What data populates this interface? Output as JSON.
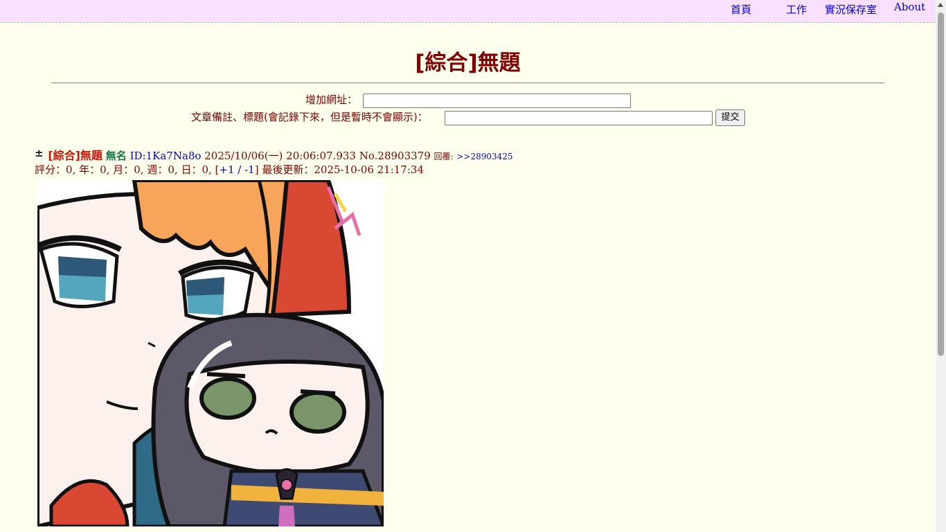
{
  "nav": {
    "home": "首頁",
    "work": "工作",
    "archive": "實況保存室",
    "about": "About"
  },
  "board": {
    "title": "[綜合]無題"
  },
  "form": {
    "url_label": "增加網址：",
    "note_label": "文章備註、標題(會記錄下來，但是暫時不會顯示)：",
    "submit_label": "提交"
  },
  "post": {
    "toggle": "±",
    "title": "[綜合]無題",
    "name": "無名",
    "id": "ID:1Ka7Na8o",
    "datetime": "2025/10/06(一) 20:06:07.933",
    "number": "No.28903379",
    "reply_label": "回覆:",
    "reply_link": ">>28903425",
    "stats": {
      "score_label": "評分：",
      "score": "0",
      "year_label": "年：",
      "year": "0",
      "month_label": "月：",
      "month": "0",
      "week_label": "週：",
      "week": "0",
      "day_label": "日：",
      "day": "0",
      "vote_up": "+1",
      "vote_down": "-1",
      "updated_label": "最後更新：",
      "updated": "2025-10-06 21:17:34"
    }
  },
  "colors": {
    "page_bg": "#ffffee",
    "topbar_bg": "#f9e0ff",
    "title": "#800000",
    "post_title": "#cc1105",
    "name": "#117743",
    "link": "#0000ee"
  }
}
